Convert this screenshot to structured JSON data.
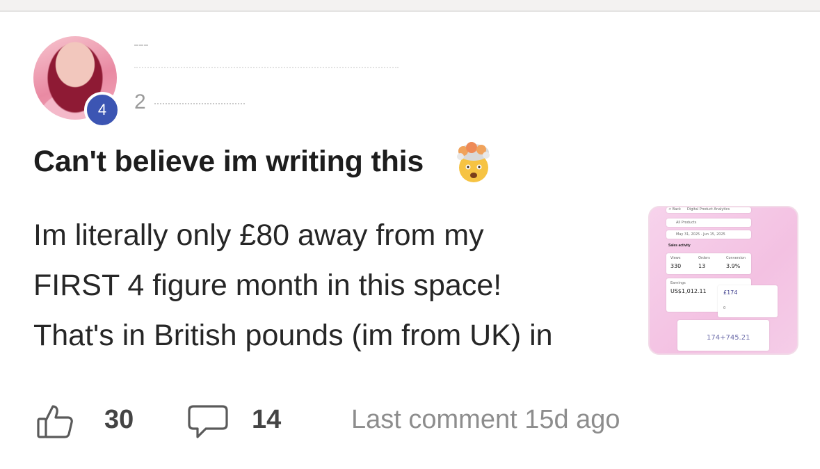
{
  "post": {
    "author": {
      "level": "4",
      "meta_prefix": "2"
    },
    "title": "Can't believe im writing this",
    "title_emoji": "exploding-head-emoji",
    "body_lines": [
      "Im literally only £80 away from my",
      "FIRST 4 figure month in this space!",
      "That's in British pounds (im from UK) in"
    ],
    "thumbnail": {
      "header": "Digital Product Analytics",
      "back": "< Back",
      "filter": "All Products",
      "date_range": "May 31, 2025 - Jun 15, 2025",
      "section": "Sales activity",
      "stats": [
        {
          "label": "Views",
          "value": "330"
        },
        {
          "label": "Orders",
          "value": "13"
        },
        {
          "label": "Conversion",
          "value": "3.9%"
        }
      ],
      "earnings_label": "Earnings",
      "earnings_value": "US$1,012.11",
      "popup_value": "£174",
      "popup_zero": "0",
      "footer_value": "174+745.21"
    }
  },
  "actions": {
    "likes": "30",
    "comments": "14",
    "last_comment": "Last comment 15d ago"
  },
  "colors": {
    "badge": "#3c55b3",
    "thumb_bg": "#f3c1e2",
    "muted_text": "#8d8d8d"
  }
}
